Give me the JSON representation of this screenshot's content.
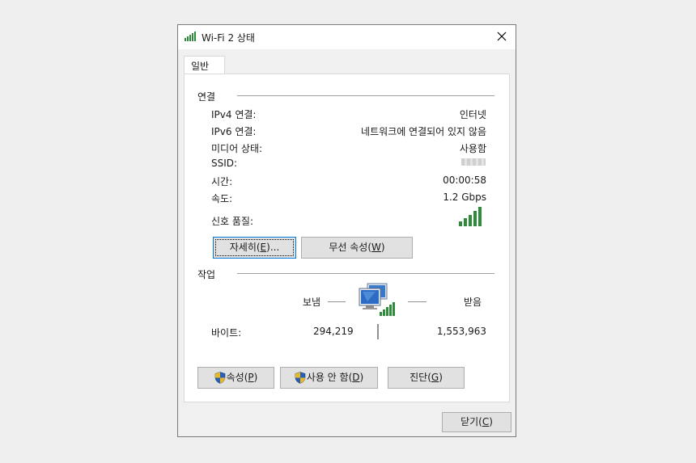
{
  "window": {
    "title": "Wi-Fi 2 상태"
  },
  "tabs": [
    {
      "label": "일반"
    }
  ],
  "connection": {
    "heading": "연결",
    "rows": [
      {
        "label": "IPv4 연결:",
        "value": "인터넷"
      },
      {
        "label": "IPv6 연결:",
        "value": "네트워크에 연결되어 있지 않음"
      },
      {
        "label": "미디어 상태:",
        "value": "사용함"
      },
      {
        "label": "SSID:",
        "value": ""
      },
      {
        "label": "시간:",
        "value": "00:00:58"
      },
      {
        "label": "속도:",
        "value": "1.2 Gbps"
      },
      {
        "label": "신호 품질:",
        "value": ""
      }
    ],
    "signal_bars": 5,
    "buttons": {
      "details": {
        "text": "자세히(",
        "mnemonic": "E",
        "suffix": ")..."
      },
      "wireless": {
        "text": "무선 속성(",
        "mnemonic": "W",
        "suffix": ")"
      }
    }
  },
  "activity": {
    "heading": "작업",
    "sent_label": "보냄",
    "received_label": "받음",
    "bytes_label": "바이트:",
    "bytes_sent": "294,219",
    "bytes_received": "1,553,963"
  },
  "footer_buttons": {
    "properties": {
      "text": "속성(",
      "mnemonic": "P",
      "suffix": ")"
    },
    "disable": {
      "text": "사용 안 함(",
      "mnemonic": "D",
      "suffix": ")"
    },
    "diagnose": {
      "text": "진단(",
      "mnemonic": "G",
      "suffix": ")"
    },
    "close": {
      "text": "닫기(",
      "mnemonic": "C",
      "suffix": ")"
    }
  },
  "colors": {
    "signal_green": "#2e8b3a",
    "focus_blue": "#0078d7",
    "monitor_blue": "#3a78c8"
  }
}
